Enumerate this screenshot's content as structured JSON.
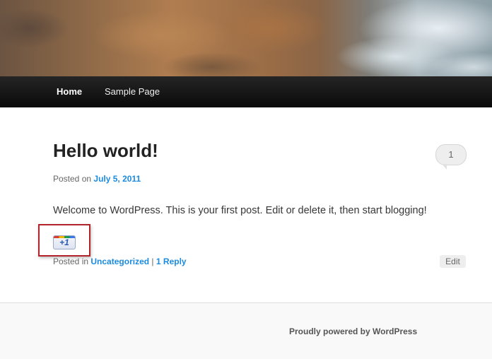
{
  "nav": {
    "home": "Home",
    "sample_page": "Sample Page"
  },
  "post": {
    "title": "Hello world!",
    "comment_count": "1",
    "posted_on_prefix": "Posted on",
    "date": "July 5, 2011",
    "content": "Welcome to WordPress. This is your first post. Edit or delete it, then start blogging!",
    "plusone_label": "+1",
    "posted_in_prefix": "Posted in",
    "category": "Uncategorized",
    "separator": "|",
    "reply_link": "1 Reply",
    "edit_label": "Edit"
  },
  "footer": {
    "credit": "Proudly powered by WordPress"
  },
  "colors": {
    "link": "#1b8be0",
    "highlight_frame": "#b2232a",
    "nav_bg": "#0a0a0a"
  }
}
